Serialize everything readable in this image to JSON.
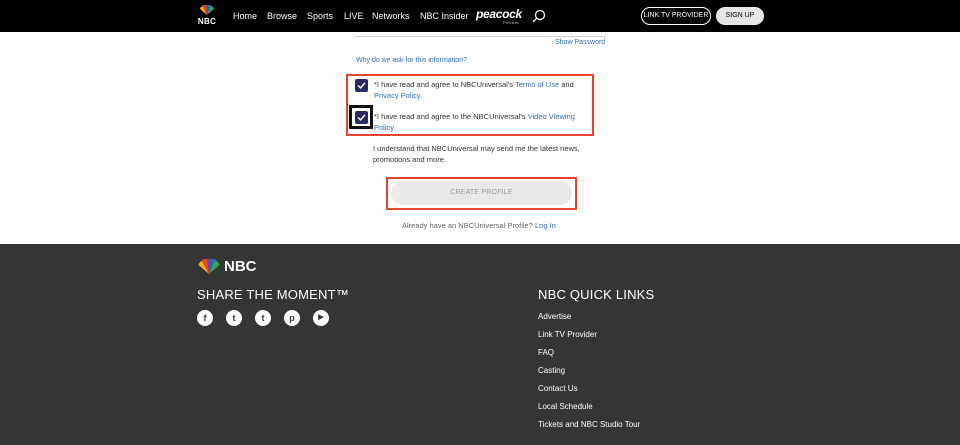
{
  "header": {
    "logo_text": "NBC",
    "nav": [
      "Home",
      "Browse",
      "Sports",
      "LIVE",
      "Networks",
      "NBC Insider"
    ],
    "peacock": "peacock",
    "peacock_sub": "Premium",
    "link_tv_label": "LINK TV PROVIDER",
    "signup_label": "SIGN UP"
  },
  "form": {
    "show_password": "Show Password",
    "why_link": "Why do we ask for this information?",
    "terms": {
      "prefix": "*I have read and agree to NBCUniversal's ",
      "terms_link": "Terms of Use",
      "middle": " and ",
      "privacy_link": "Privacy Policy",
      "suffix": "."
    },
    "video": {
      "prefix": "*I have read and agree to the NBCUniversal's ",
      "link": "Video Viewing Policy",
      "suffix": "."
    },
    "promo_text": "I understand that NBCUniversal may send me the latest news, promotions and more.",
    "create_label": "CREATE PROFILE",
    "already_text": "Already have an NBCUniversal Profile? ",
    "login_link": "Log In"
  },
  "footer": {
    "logo_text": "NBC",
    "share_heading": "SHARE THE MOMENT™",
    "social": [
      "f",
      "t",
      "t",
      "p",
      "▶"
    ],
    "quick_heading": "NBC QUICK LINKS",
    "quick_links": [
      "Advertise",
      "Link TV Provider",
      "FAQ",
      "Casting",
      "Contact Us",
      "Local Schedule",
      "Tickets and NBC Studio Tour"
    ]
  },
  "colors": {
    "accent_link": "#2d6db5",
    "checkbox": "#2b2a5e",
    "highlight": "#e3462a",
    "footer_bg": "#353535"
  }
}
